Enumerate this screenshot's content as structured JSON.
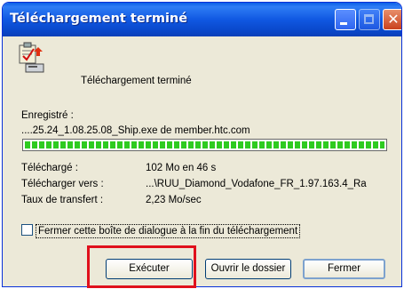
{
  "window": {
    "title": "Téléchargement terminé"
  },
  "header": {
    "message": "Téléchargement terminé"
  },
  "saved": {
    "label": "Enregistré :",
    "source": "....25.24_1.08.25.08_Ship.exe de member.htc.com"
  },
  "progress": {
    "percent": 100,
    "color": "#2ecb20"
  },
  "details": [
    {
      "label": "Téléchargé :",
      "value": "102 Mo en 46 s"
    },
    {
      "label": "Télécharger vers :",
      "value": "...\\RUU_Diamond_Vodafone_FR_1.97.163.4_Ra"
    },
    {
      "label": "Taux de transfert :",
      "value": "2,23 Mo/sec"
    }
  ],
  "checkbox": {
    "label": "Fermer cette boîte de dialogue à la fin du téléchargement",
    "checked": false
  },
  "buttons": {
    "execute": "Exécuter",
    "open_folder": "Ouvrir le dossier",
    "close": "Fermer"
  },
  "icons": [
    "download-complete-icon",
    "minimize-icon",
    "maximize-icon",
    "close-icon"
  ],
  "highlight_color": "#e0101c"
}
